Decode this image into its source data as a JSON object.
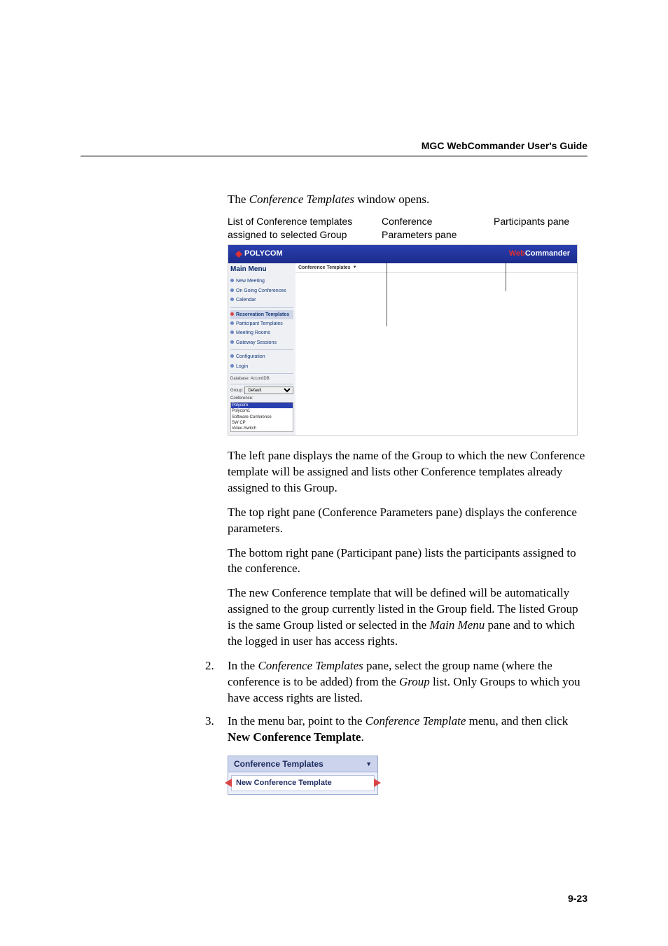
{
  "header": {
    "guide_title": "MGC WebCommander User's Guide"
  },
  "intro": {
    "prefix": "The ",
    "em": "Conference Templates",
    "suffix": " window opens."
  },
  "labels": {
    "l1_a": "List of Conference templates",
    "l1_b": "assigned to selected Group",
    "l2_a": "Conference",
    "l2_b": "Parameters pane",
    "l3": "Participants pane"
  },
  "screenshot": {
    "brand": "POLYCOM",
    "app_prefix": "Web",
    "app_suffix": "Commander",
    "main_menu": "Main Menu",
    "topbar": "Conference Templates",
    "menu_items": [
      "New Meeting",
      "On Going Conferences",
      "Calendar",
      "Reservation Templates",
      "Participant Templates",
      "Meeting Rooms",
      "Gateway Sessions",
      "Configuration",
      "Login"
    ],
    "hl_index": 3,
    "database_label": "Database:",
    "database_value": "AccordDB",
    "group_label": "Group:",
    "group_value": "Default",
    "conference_label": "Conference:",
    "conf_list": [
      "Polycom",
      "Polycom1",
      "Software-Conference",
      "SW CP",
      "Video-Switch"
    ],
    "conf_sel_index": 0
  },
  "paragraphs": {
    "p1": "The left pane displays the name of the Group to which the new Conference template will be assigned and lists other Conference templates already assigned to this Group.",
    "p2": "The top right pane (Conference Parameters pane) displays the conference parameters.",
    "p3": "The bottom right pane (Participant pane) lists the participants assigned to the conference.",
    "p4_a": "The new Conference template that will be defined will be automatically assigned to the group currently listed in the Group field. The listed Group is the same Group listed or selected in the ",
    "p4_em": "Main Menu",
    "p4_b": " pane and to which the logged in user has access rights."
  },
  "steps": {
    "s2_num": "2.",
    "s2_a": "In the ",
    "s2_em1": "Conference Templates",
    "s2_b": " pane, select the group name (where the conference is to be added) from the ",
    "s2_em2": "Group",
    "s2_c": " list. Only Groups to which you have access rights are listed.",
    "s3_num": "3.",
    "s3_a": "In the menu bar, point to the ",
    "s3_em": "Conference Template",
    "s3_b": " menu, and then click ",
    "s3_bold": "New Conference Template",
    "s3_c": "."
  },
  "dropdown": {
    "header": "Conference Templates",
    "item": "New Conference Template"
  },
  "page_number": "9-23"
}
